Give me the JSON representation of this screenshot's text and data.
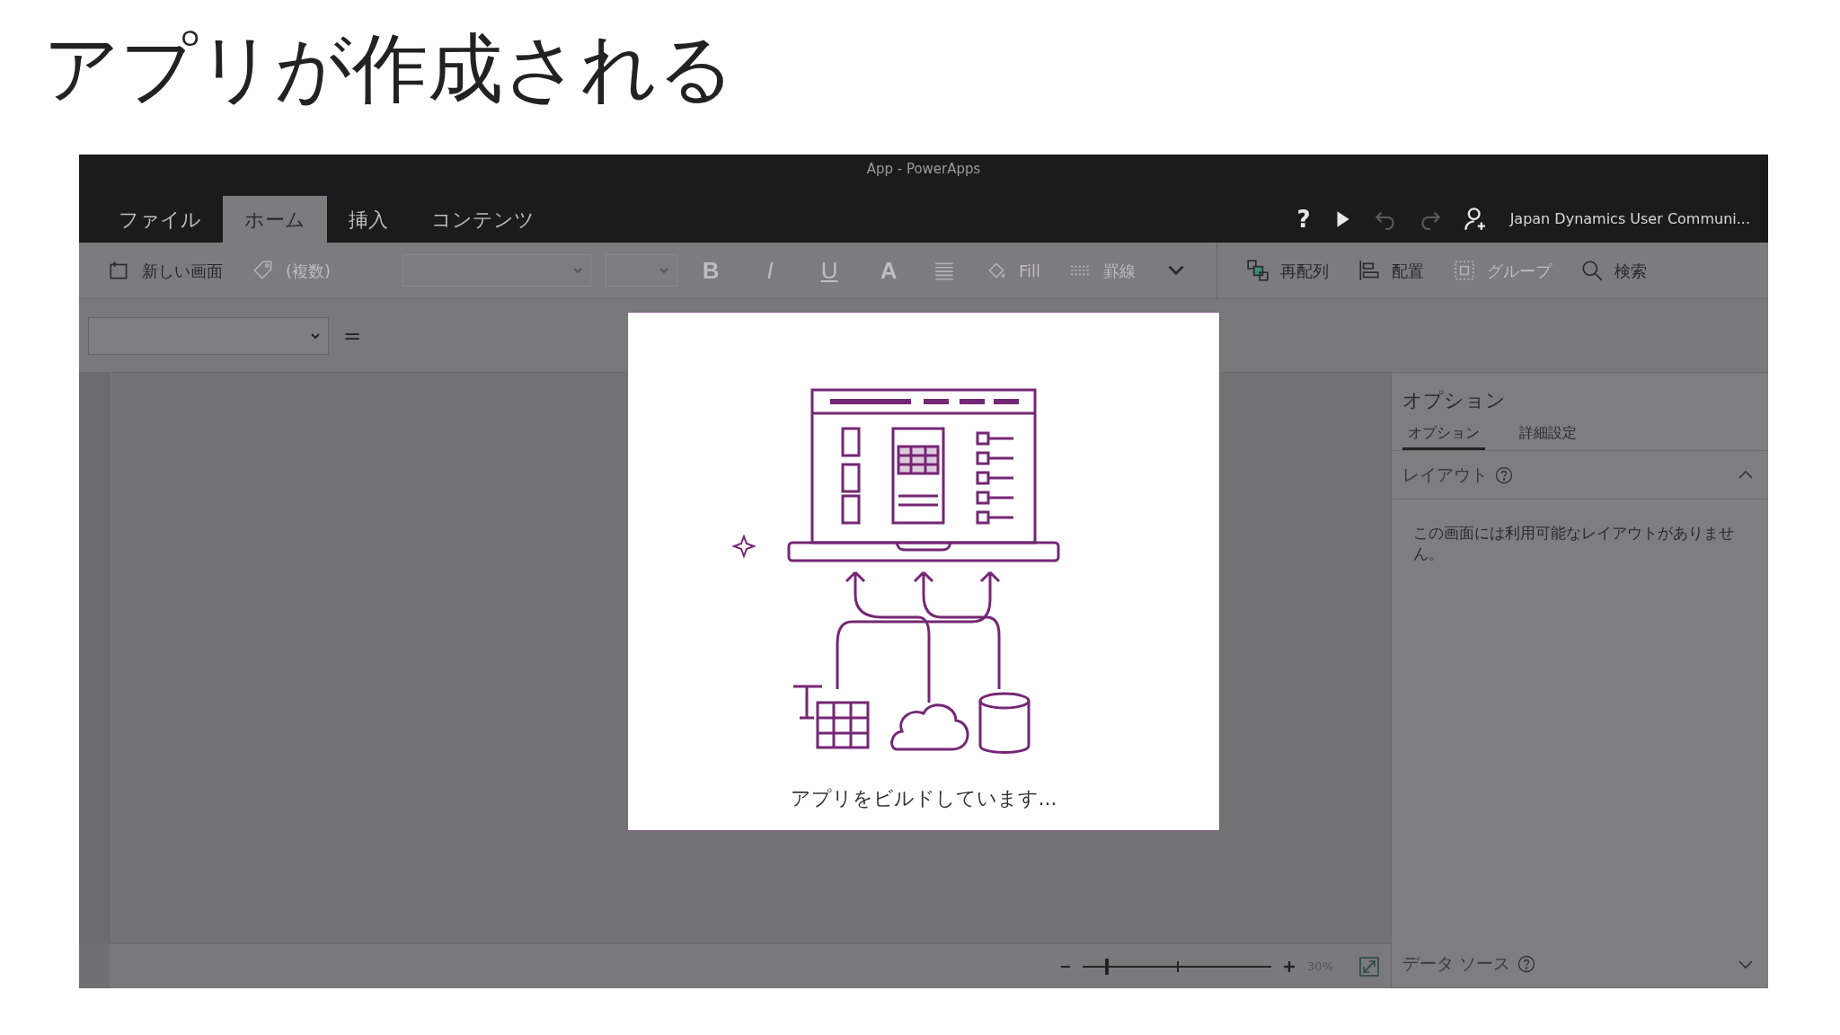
{
  "slide_title": "アプリが作成される",
  "window": {
    "title": "App - PowerApps"
  },
  "tabs": [
    {
      "label": "ファイル",
      "selected": false
    },
    {
      "label": "ホーム",
      "selected": true
    },
    {
      "label": "挿入",
      "selected": false
    },
    {
      "label": "コンテンツ",
      "selected": false
    }
  ],
  "title_actions": [
    {
      "kind": "help",
      "label": "?",
      "disabled": false
    },
    {
      "kind": "play",
      "disabled": false
    },
    {
      "kind": "undo",
      "disabled": true
    },
    {
      "kind": "redo",
      "disabled": true
    },
    {
      "kind": "account",
      "disabled": false
    }
  ],
  "account_name": "Japan Dynamics User Communi...",
  "toolbar": [
    {
      "kind": "button",
      "label": "新しい画面",
      "disabled": false
    },
    {
      "kind": "button",
      "label": "(複数)",
      "disabled": true
    },
    {
      "kind": "fontselect",
      "disabled": true
    },
    {
      "kind": "sizeselect",
      "disabled": true
    },
    {
      "kind": "glyph",
      "label": "B",
      "disabled": true
    },
    {
      "kind": "glyph",
      "label": "I",
      "disabled": true
    },
    {
      "kind": "glyph",
      "label": "U",
      "disabled": true
    },
    {
      "kind": "glyph",
      "label": "A",
      "disabled": true
    },
    {
      "kind": "button",
      "disabled": true
    },
    {
      "kind": "button",
      "label": "Fill",
      "disabled": true
    },
    {
      "kind": "button",
      "label": "罫線",
      "disabled": true
    },
    {
      "kind": "button",
      "disabled": false
    },
    {
      "kind": "separator"
    },
    {
      "kind": "button",
      "label": "再配列",
      "disabled": false
    },
    {
      "kind": "button",
      "label": "配置",
      "disabled": false
    },
    {
      "kind": "button",
      "label": "グループ",
      "disabled": true
    },
    {
      "kind": "button",
      "label": "検索",
      "disabled": false
    }
  ],
  "formula_bar": {
    "operator": "="
  },
  "dialog": {
    "message": "アプリをビルドしています..."
  },
  "zoom": {
    "level": 0.13,
    "reading": "30%"
  },
  "right_panel": {
    "title": "オプション",
    "tabs": [
      {
        "label": "オプション",
        "selected": true
      },
      {
        "label": "詳細設定",
        "selected": false
      }
    ],
    "sections": [
      {
        "label": "レイアウト",
        "expanded": true,
        "message": "この画面には利用可能なレイアウトがありません。"
      },
      {
        "label": "データ ソース",
        "expanded": false
      }
    ]
  }
}
